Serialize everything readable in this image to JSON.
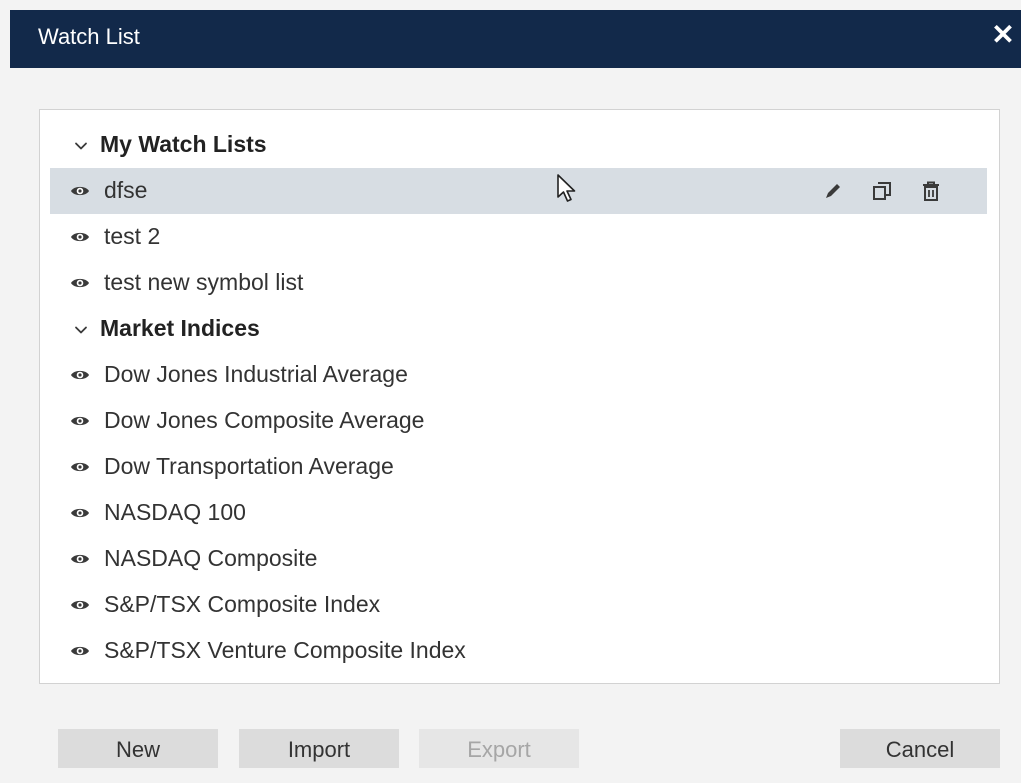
{
  "dialog": {
    "title": "Watch List",
    "close_label": "✕"
  },
  "groups": [
    {
      "label": "My Watch Lists",
      "items": [
        {
          "label": "dfse",
          "selected": true
        },
        {
          "label": "test 2"
        },
        {
          "label": "test new symbol list"
        }
      ]
    },
    {
      "label": "Market Indices",
      "items": [
        {
          "label": "Dow Jones Industrial Average"
        },
        {
          "label": "Dow Jones Composite Average"
        },
        {
          "label": "Dow Transportation Average"
        },
        {
          "label": "NASDAQ 100"
        },
        {
          "label": "NASDAQ Composite"
        },
        {
          "label": "S&P/TSX Composite Index"
        },
        {
          "label": "S&P/TSX Venture Composite Index"
        }
      ]
    }
  ],
  "row_actions": [
    "edit-icon",
    "copy-icon",
    "delete-icon"
  ],
  "buttons": {
    "new": "New",
    "import": "Import",
    "export": "Export",
    "cancel": "Cancel"
  },
  "colors": {
    "titlebar": "#12294a",
    "selected_row": "#d7dde3",
    "icon": "#3a3a3a"
  }
}
